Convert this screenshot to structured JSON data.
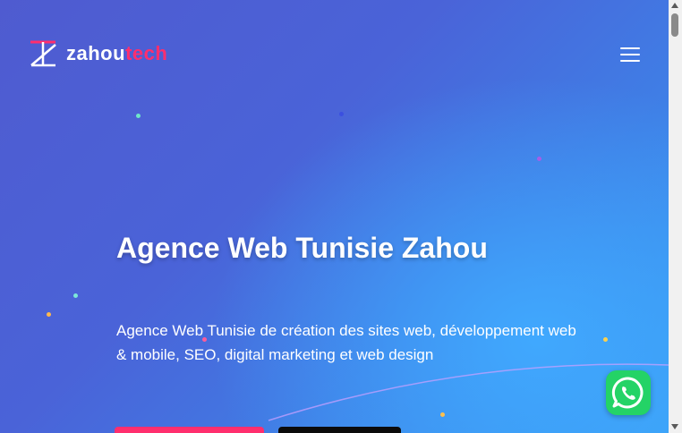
{
  "brand": {
    "name_part1": "zahou",
    "name_part2": "tech",
    "accent_color": "#ff2e6e"
  },
  "header": {
    "menu_icon": "hamburger-menu-icon"
  },
  "hero": {
    "title": "Agence Web Tunisie Zahou",
    "description": "Agence Web Tunisie de création des sites web, développement web & mobile, SEO, digital marketing et web design",
    "primary_button_color": "#ff2e6e",
    "secondary_button_color": "#0b0b0b",
    "background_colors": [
      "#4f5bd0",
      "#3f7fe6",
      "#3aa0f5"
    ]
  },
  "floating_widget": {
    "icon": "whatsapp-icon",
    "color": "#24d366"
  }
}
